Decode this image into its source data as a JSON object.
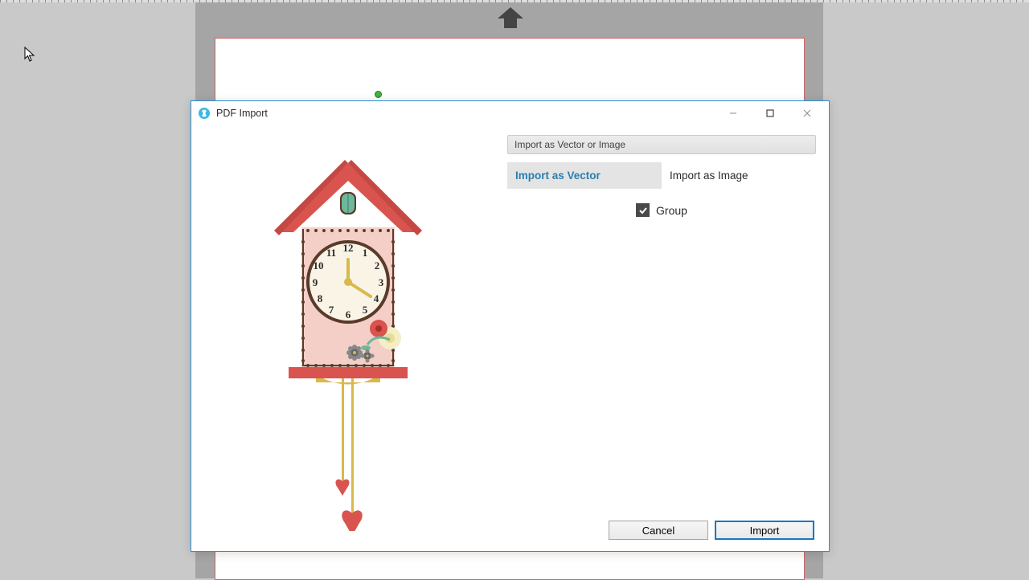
{
  "dialog": {
    "title": "PDF Import",
    "section_header": "Import as Vector or Image",
    "tabs": {
      "vector": "Import as Vector",
      "image": "Import as Image"
    },
    "group_checkbox_label": "Group",
    "group_checked": true,
    "buttons": {
      "cancel": "Cancel",
      "import": "Import"
    }
  },
  "clock_face_numbers": [
    "12",
    "1",
    "2",
    "3",
    "4",
    "5",
    "6",
    "7",
    "8",
    "9",
    "10",
    "11"
  ]
}
